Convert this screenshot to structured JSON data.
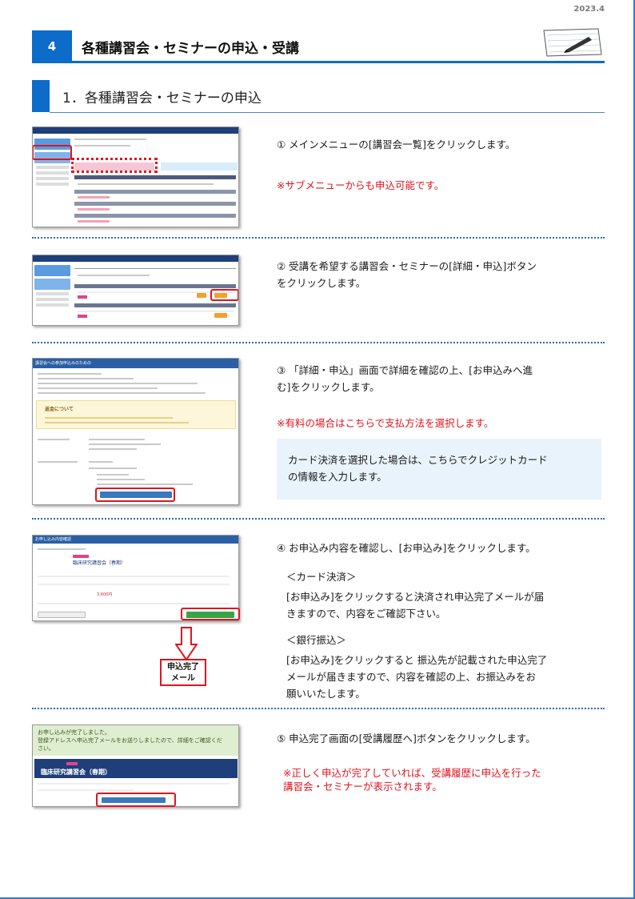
{
  "date": "2023.4",
  "chapter": {
    "number": "4",
    "title": "各種講習会・セミナーの申込・受講"
  },
  "section": {
    "title": "1．各種講習会・セミナーの申込"
  },
  "steps": [
    {
      "text": "① メインメニューの[講習会一覧]をクリックします。",
      "note": "※サブメニューからも申込可能です。"
    },
    {
      "text_line1": "② 受講を希望する講習会・セミナーの[詳細・申込]ボタン",
      "text_line2": "をクリックします。"
    },
    {
      "text_line1": "③ 「詳細・申込」画面で詳細を確認の上、[お申込みへ進",
      "text_line2": "む]をクリックします。",
      "note": "※有料の場合はこちらで支払方法を選択します。",
      "info_line1": "カード決済を選択した場合は、こちらでクレジットカード",
      "info_line2": "の情報を入力します。"
    },
    {
      "text": "④ お申込み内容を確認し、[お申込み]をクリックします。",
      "card_heading": "＜カード決済＞",
      "card_line1": "[お申込み]をクリックすると決済され申込完了メールが届",
      "card_line2": "きますので、内容をご確認下さい。",
      "bank_heading": "＜銀行振込＞",
      "bank_line1": "[お申込み]をクリックすると 振込先が記載された申込完了",
      "bank_line2": "メールが届きますので、内容を確認の上、お振込みをお",
      "bank_line3": "願いいたします。",
      "mail_line1": "申込完了",
      "mail_line2": "メール"
    },
    {
      "text": "⑤ 申込完了画面の[受講履歴へ]ボタンをクリックします。",
      "note_line1": "※正しく申込が完了していれば、受講履歴に申込を行った",
      "note_line2": "講習会・セミナーが表示されます。"
    }
  ],
  "shots": {
    "s3": {
      "header": "講習会への参加申込みのための",
      "refund_heading": "返金について"
    },
    "s4": {
      "header": "お申し込み内容確認",
      "course": "臨床研究講習会（春期）",
      "price": "3,600円"
    },
    "s5": {
      "done1": "お申し込みが完了しました。",
      "done2": "登録アドレスへ申込完了メールをお送りしましたので、詳細をご確認くだ",
      "done3": "さい。",
      "course": "臨床研究講習会（春期）"
    }
  },
  "colors": {
    "accent": "#0d6bc9",
    "highlight": "#e0141e",
    "info_bg": "#e9f3fb"
  }
}
